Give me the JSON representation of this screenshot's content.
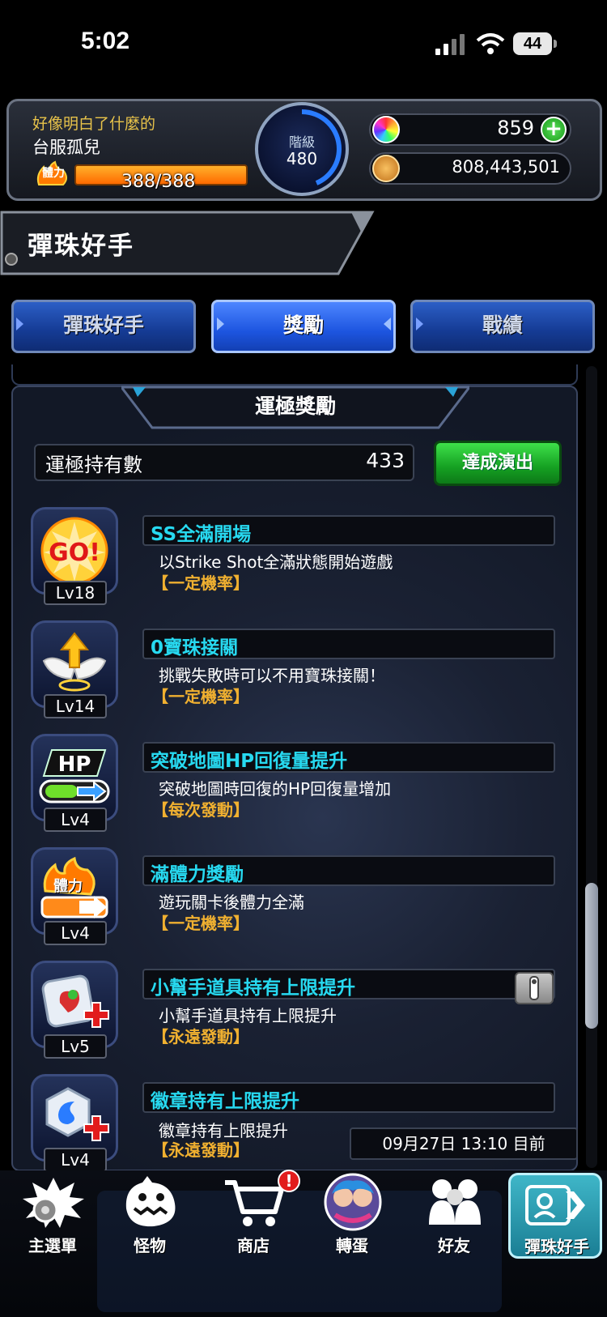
{
  "status_bar": {
    "time": "5:02",
    "battery": "44"
  },
  "header": {
    "player_title": "好像明白了什麼的",
    "server": "台服孤兒",
    "stamina_label": "體力",
    "stamina": "388/388",
    "rank_label": "階級",
    "rank": "480",
    "gems": "859",
    "gold": "808,443,501"
  },
  "page_title": "彈珠好手",
  "tabs": [
    {
      "label": "彈珠好手"
    },
    {
      "label": "獎勵"
    },
    {
      "label": "戰績"
    }
  ],
  "section": {
    "title": "運極獎勵",
    "count_label": "運極持有數",
    "count_value": "433",
    "perform_button": "達成演出"
  },
  "rewards": [
    {
      "icon": "go-icon",
      "level": "Lv18",
      "name": "SS全滿開場",
      "desc": "以Strike Shot全滿狀態開始遊戲",
      "tag": "【一定機率】"
    },
    {
      "icon": "angel-wings-icon",
      "level": "Lv14",
      "name": "0寶珠接關",
      "desc": "挑戰失敗時可以不用寶珠接關！",
      "tag": "【一定機率】"
    },
    {
      "icon": "hp-icon",
      "level": "Lv4",
      "name": "突破地圖HP回復量提升",
      "desc": "突破地圖時回復的HP回復量增加",
      "tag": "【每次發動】"
    },
    {
      "icon": "stamina-icon",
      "level": "Lv4",
      "name": "滿體力獎勵",
      "desc": "遊玩關卡後體力全滿",
      "tag": "【一定機率】"
    },
    {
      "icon": "helper-item-icon",
      "level": "Lv5",
      "name": "小幫手道具持有上限提升",
      "desc": "小幫手道具持有上限提升",
      "tag": "【永遠發動】"
    },
    {
      "icon": "badge-icon",
      "level": "Lv4",
      "name": "徽章持有上限提升",
      "desc": "徽章持有上限提升",
      "tag": "【永遠發動】"
    }
  ],
  "date_stamp": "09月27日 13:10 目前",
  "nav": [
    {
      "label": "主選單",
      "icon": "main-menu-icon"
    },
    {
      "label": "怪物",
      "icon": "monster-icon"
    },
    {
      "label": "商店",
      "icon": "cart-icon"
    },
    {
      "label": "轉蛋",
      "icon": "gacha-icon"
    },
    {
      "label": "好友",
      "icon": "friends-icon"
    },
    {
      "label": "彈珠好手",
      "icon": "id-card-icon"
    }
  ],
  "nav_badge": "!",
  "colors": {
    "accent_cyan": "#27d9f0",
    "tag_orange": "#f0b030",
    "tab_blue": "#1d55e0",
    "button_green": "#15a022"
  }
}
